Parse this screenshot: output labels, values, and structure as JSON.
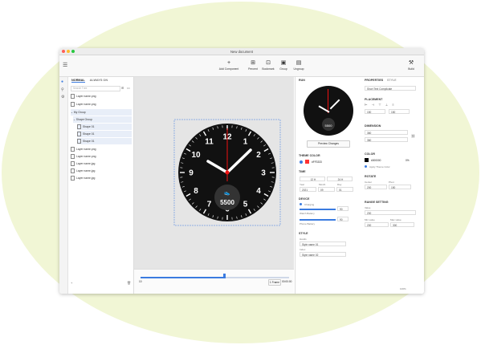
{
  "window": {
    "title": "New document"
  },
  "toolbar": {
    "add": {
      "icon": "+",
      "label": "Add Component"
    },
    "percent": {
      "icon": "⊞",
      "label": "Percent"
    },
    "bookmark": {
      "icon": "⊡",
      "label": "Bookmark"
    },
    "group": {
      "icon": "▣",
      "label": "Group"
    },
    "ungroup": {
      "icon": "▤",
      "label": "Ungroup"
    },
    "build": {
      "icon": "⚒",
      "label": "Build"
    }
  },
  "layers": {
    "tab_normal": "NORMAL",
    "tab_always_on": "ALWAYS ON",
    "search_placeholder": "Search Tree",
    "items": [
      "Layer name.png",
      "Layer name.png",
      "Shape Group",
      "Shape 01",
      "Shape 01",
      "Shape 01",
      "Layer name.png",
      "Layer name.png",
      "Layer name.jpg",
      "Layer name.jpg",
      "Layer name.jpg"
    ],
    "group_label": "My Group"
  },
  "watch": {
    "numbers": [
      "12",
      "1",
      "2",
      "3",
      "4",
      "5",
      "6",
      "7",
      "8",
      "9",
      "10",
      "11"
    ],
    "steps": "5500"
  },
  "timeline": {
    "fps": "1 Frame",
    "time": "00:00:00",
    "start": "10"
  },
  "preview": {
    "title": "RUN",
    "steps": "5500",
    "preview_button": "Preview Changes",
    "theme_color": "THEME COLOR",
    "theme_hex": "#FF3333",
    "time": "TIME",
    "hour_label": "12 H",
    "format_label": "24 H",
    "year_label": "Year",
    "month_label": "Month",
    "day_label": "Day",
    "year": "2021",
    "month": "09",
    "day": "01",
    "device": "DEVICE",
    "charging": "Charging",
    "watch_battery": "Watch Battery",
    "watch_battery_val": "90",
    "phone_battery": "Phone Battery",
    "phone_battery_val": "90",
    "style": "STYLE",
    "hands_label": "Hands",
    "hands_val": "Style name 01",
    "index_label": "Index",
    "index_val": "Style name 02"
  },
  "props": {
    "tab_properties": "PROPERTIES",
    "tab_style": "STYLE",
    "complication": "Short Text Complicate",
    "placement": "PLACEMENT",
    "px": "150",
    "py": "150",
    "dimension": "DIMENSION",
    "w": "360",
    "h": "360",
    "color": "COLOR",
    "color_hex": "#000000",
    "opacity": "0%",
    "apply_theme": "Apply Theme Color",
    "rotate": "ROTATE",
    "center_label": "Center",
    "pivot_label": "Pivot",
    "center": "200",
    "pivot": "150",
    "range": "RANGE SETTING",
    "value_label": "Value",
    "value": "200",
    "min_label": "Min value",
    "max_label": "Max value",
    "min": "200",
    "max": "300"
  },
  "status": {
    "zoom": "100%"
  }
}
